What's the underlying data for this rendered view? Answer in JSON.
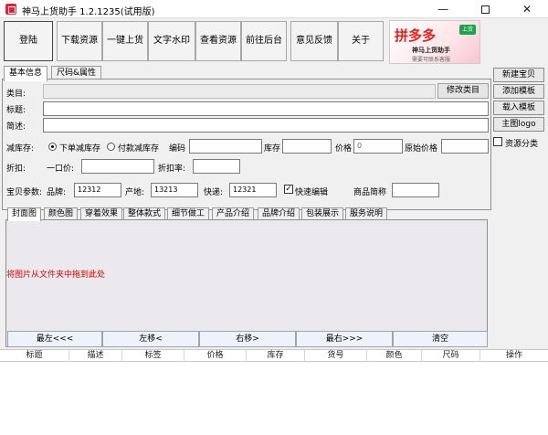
{
  "window": {
    "title": "神马上货助手 1.2.1235(试用版)",
    "min_glyph": "—",
    "close_glyph": "✕"
  },
  "toolbar": {
    "buttons": [
      "登陆",
      "下载资源",
      "一键上货",
      "文字水印",
      "查看资源",
      "前往后台",
      "意见反馈",
      "关于"
    ]
  },
  "promo": {
    "brand": "拼多多",
    "badge": "上货",
    "line1": "神马上货助手",
    "line2": "需要可联系客服"
  },
  "tabs": [
    "基本信息",
    "尺码&属性"
  ],
  "form": {
    "category_label": "类目:",
    "change_category": "修改类目",
    "title_label": "标题:",
    "desc_label": "简述:",
    "stock_label": "减库存:",
    "radio_order": "下单减库存",
    "radio_pay": "付款减库存",
    "code_label": "编码",
    "inventory_label": "库存",
    "price_label": "价格",
    "price_value": "0",
    "orig_price_label": "原始价格",
    "discount_label": "折扣:",
    "fixed_price_label": "一口价:",
    "discount_rate_label": "折扣率:",
    "params_label": "宝贝参数:",
    "brand_label": "品牌:",
    "brand_value": "12312",
    "origin_label": "产地:",
    "origin_value": "13213",
    "express_label": "快递:",
    "express_value": "12321",
    "quick_edit": "快速编辑",
    "product_short_label": "商品简称"
  },
  "side": {
    "new": "新建宝贝",
    "add_template": "添加模板",
    "load_template": "载入模板",
    "main_logo": "主图logo",
    "resource_category": "资源分类"
  },
  "image_tabs": [
    "封面图",
    "颜色图",
    "穿着效果",
    "整体款式",
    "细节做工",
    "产品介绍",
    "品牌介绍",
    "包装展示",
    "服务说明"
  ],
  "drop_hint": "将图片从文件夹中拖到此处",
  "image_buttons": [
    "最左<<<",
    "左移<",
    "右移>",
    "最右>>>",
    "清空"
  ],
  "grid_columns": [
    "标题",
    "描述",
    "标签",
    "价格",
    "库存",
    "货号",
    "颜色",
    "尺码",
    "操作"
  ]
}
